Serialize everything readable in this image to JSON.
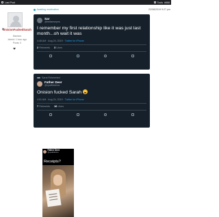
{
  "topbar": {
    "title": "Last Post",
    "tools": "Tools",
    "post_id": "#668"
  },
  "post": {
    "moderation_status": "Awaiting moderation",
    "date": "22/08/2019 9:27 pm"
  },
  "user": {
    "username": "OnisionFuckedSarah",
    "title": "Member",
    "joined": "Joined: 1 hour ago",
    "posts": "Posts: 0"
  },
  "tweet1": {
    "name": "Sar",
    "handle": "@bellaeseyes",
    "text": "I remember my first relationship like it was just last month...oh wait it was",
    "time": "4:48 AM · Aug 24, 2019",
    "via": "Twitter for iPhone",
    "retweets_count": "2",
    "retweets_label": "Retweets",
    "likes_count": "3",
    "likes_label": "Likes"
  },
  "tweet2": {
    "retweeted_by": "Sarai Retweeted",
    "name": "Father Deer",
    "handle": "@quallidarina",
    "text": "Onision fucked Sarah",
    "time": "4:51 AM · Aug 24, 2019",
    "via": "Twitter for iPhone",
    "retweets_count": "7",
    "retweets_label": "Retweets",
    "likes_count": "16",
    "likes_label": "Likes"
  },
  "embedded": {
    "name": "Father Deer",
    "handle": "@quallidarina",
    "caption": "Receipts?"
  }
}
